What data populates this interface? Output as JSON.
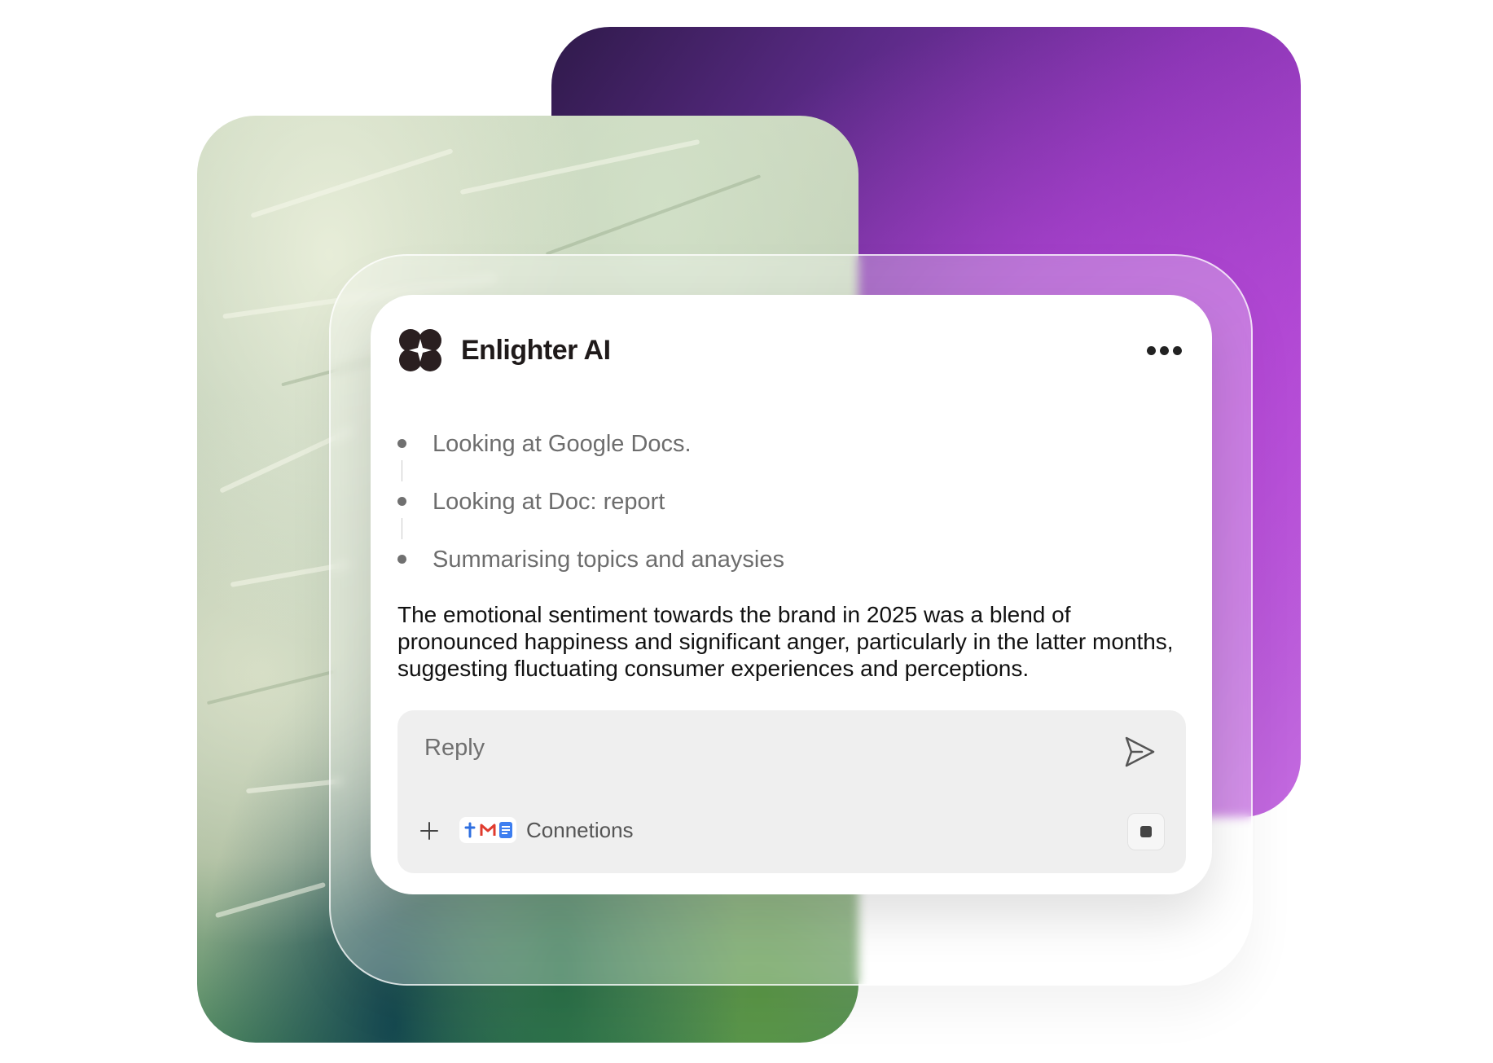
{
  "app": {
    "title": "Enlighter AI",
    "logo_icon": "four-petal-sparkle-logo",
    "menu_icon": "more-horizontal-icon"
  },
  "steps": [
    {
      "label": "Looking at Google Docs."
    },
    {
      "label": "Looking at Doc: report"
    },
    {
      "label": "Summarising topics and anaysies"
    }
  ],
  "summary": "The emotional sentiment towards the brand in 2025 was a blend of pronounced happiness and significant anger, particularly in the latter months, suggesting fluctuating consumer experiences and perceptions.",
  "composer": {
    "placeholder": "Reply",
    "send_icon": "send-icon",
    "add_icon": "plus-icon",
    "connections_label": "Connetions",
    "connection_icons": [
      "jira-icon",
      "gmail-icon",
      "google-docs-icon"
    ],
    "stop_icon": "stop-icon"
  },
  "colors": {
    "purple_start": "#2f1a4a",
    "purple_end": "#c46be0",
    "panel_bg": "#ffffff",
    "reply_bg": "#efefef"
  }
}
